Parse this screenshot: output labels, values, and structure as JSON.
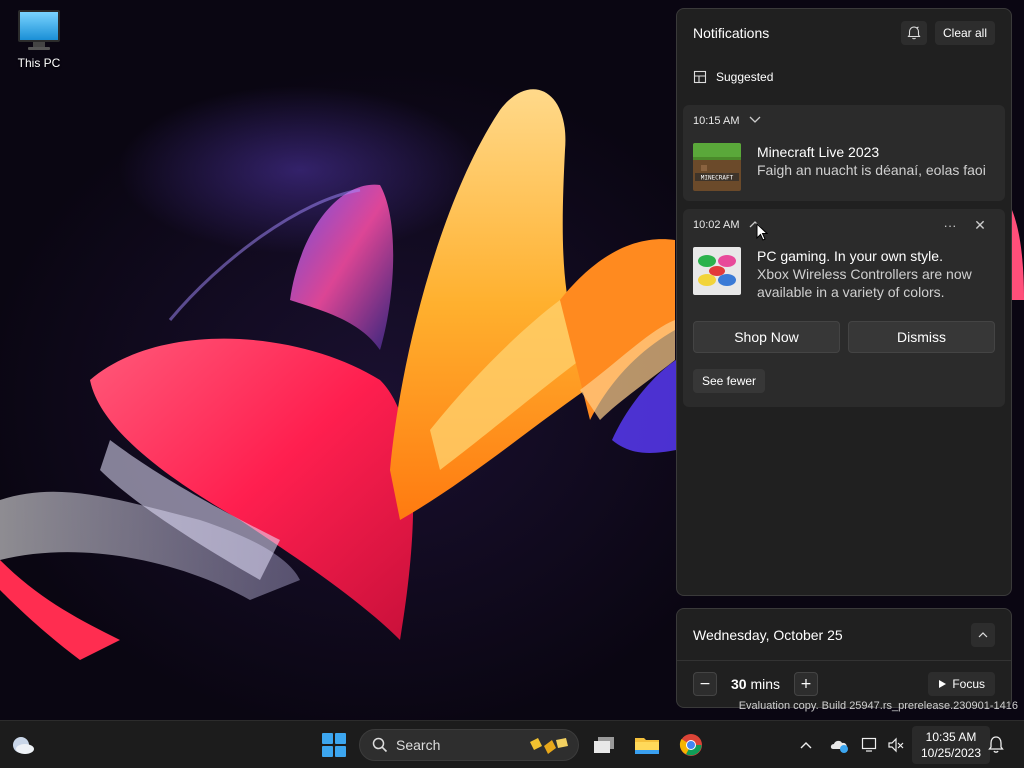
{
  "desktop": {
    "icons": [
      {
        "label": "This PC",
        "icon": "this-pc-icon"
      }
    ]
  },
  "notifications": {
    "title": "Notifications",
    "dnd_icon": "do-not-disturb-icon",
    "clear_all": "Clear all",
    "section_label": "Suggested",
    "cards": [
      {
        "time": "10:15 AM",
        "title": "Minecraft Live 2023",
        "body": "Faigh an nuacht is déanaí, eolas faoi",
        "thumb": "minecraft-icon"
      },
      {
        "time": "10:02 AM",
        "title": "PC gaming. In your own style.",
        "body": "Xbox Wireless Controllers are now available in a variety of colors.",
        "thumb": "xbox-controllers-icon",
        "actions": [
          "Shop Now",
          "Dismiss"
        ],
        "see_fewer": "See fewer"
      }
    ]
  },
  "calendar": {
    "date": "Wednesday, October 25",
    "focus_minutes": "30",
    "focus_unit": "mins",
    "focus_button": "Focus"
  },
  "watermark": "Evaluation copy. Build 25947.rs_prerelease.230901-1416",
  "taskbar": {
    "search_placeholder": "Search",
    "apps": [
      "task-view-icon",
      "file-explorer-icon",
      "chrome-icon"
    ],
    "time": "10:35 AM",
    "date": "10/25/2023"
  },
  "colors": {
    "accent": "#3ca6f0",
    "panel_bg": "#202020",
    "card_bg": "#2b2b2b",
    "taskbar_bg": "#1c1c1c"
  }
}
